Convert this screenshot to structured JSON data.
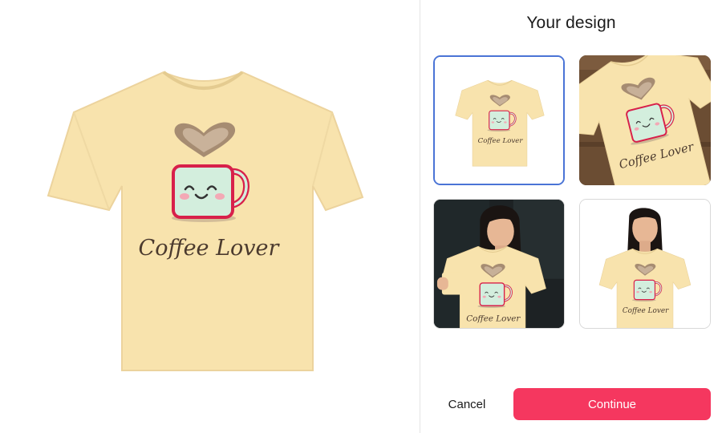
{
  "panel": {
    "title": "Your design"
  },
  "design": {
    "print_text": "Coffee Lover",
    "shirt_color": "#f8e3ad",
    "mug_color": "#d3eedd",
    "mug_outline_color": "#d8204a",
    "heart_color": "#a68c72"
  },
  "thumbnails": [
    {
      "name": "flat-tshirt-mockup",
      "selected": true
    },
    {
      "name": "tshirt-on-table-mockup",
      "selected": false
    },
    {
      "name": "woman-with-mug-mockup",
      "selected": false
    },
    {
      "name": "woman-studio-mockup",
      "selected": false
    }
  ],
  "actions": {
    "cancel_label": "Cancel",
    "continue_label": "Continue"
  },
  "colors": {
    "accent": "#f5375f",
    "selected_border": "#4a74d6"
  }
}
